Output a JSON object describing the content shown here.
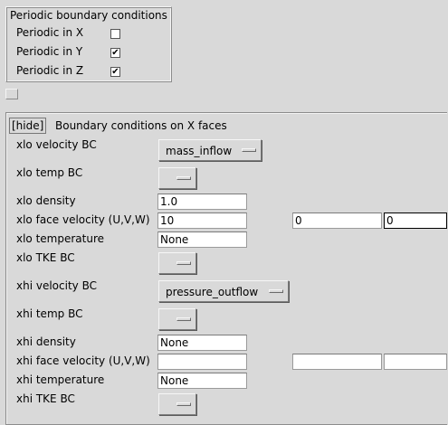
{
  "periodic": {
    "title": "Periodic boundary conditions",
    "items": [
      {
        "label": "Periodic in X",
        "checked": false
      },
      {
        "label": "Periodic in Y",
        "checked": true
      },
      {
        "label": "Periodic in Z",
        "checked": true
      }
    ]
  },
  "xfaces": {
    "hide_label": "[hide]",
    "title": "Boundary conditions on X faces",
    "xlo_velocity_bc": {
      "label": "xlo velocity BC",
      "value": "mass_inflow"
    },
    "xlo_temp_bc": {
      "label": "xlo temp BC",
      "value": ""
    },
    "xlo_density": {
      "label": "xlo density",
      "value": "1.0"
    },
    "xlo_face_velocity": {
      "label": "xlo face velocity (U,V,W)",
      "u": "10",
      "v": "0",
      "w": "0"
    },
    "xlo_temperature": {
      "label": "xlo temperature",
      "value": "None"
    },
    "xlo_tke_bc": {
      "label": "xlo TKE BC",
      "value": ""
    },
    "xhi_velocity_bc": {
      "label": "xhi velocity BC",
      "value": "pressure_outflow"
    },
    "xhi_temp_bc": {
      "label": "xhi temp BC",
      "value": ""
    },
    "xhi_density": {
      "label": "xhi density",
      "value": "None"
    },
    "xhi_face_velocity": {
      "label": "xhi face velocity (U,V,W)",
      "u": "",
      "v": "",
      "w": ""
    },
    "xhi_temperature": {
      "label": "xhi temperature",
      "value": "None"
    },
    "xhi_tke_bc": {
      "label": "xhi TKE BC",
      "value": ""
    }
  },
  "icons": {
    "checkmark": "check-mark",
    "menu_indicator": "option-menu-indicator"
  }
}
